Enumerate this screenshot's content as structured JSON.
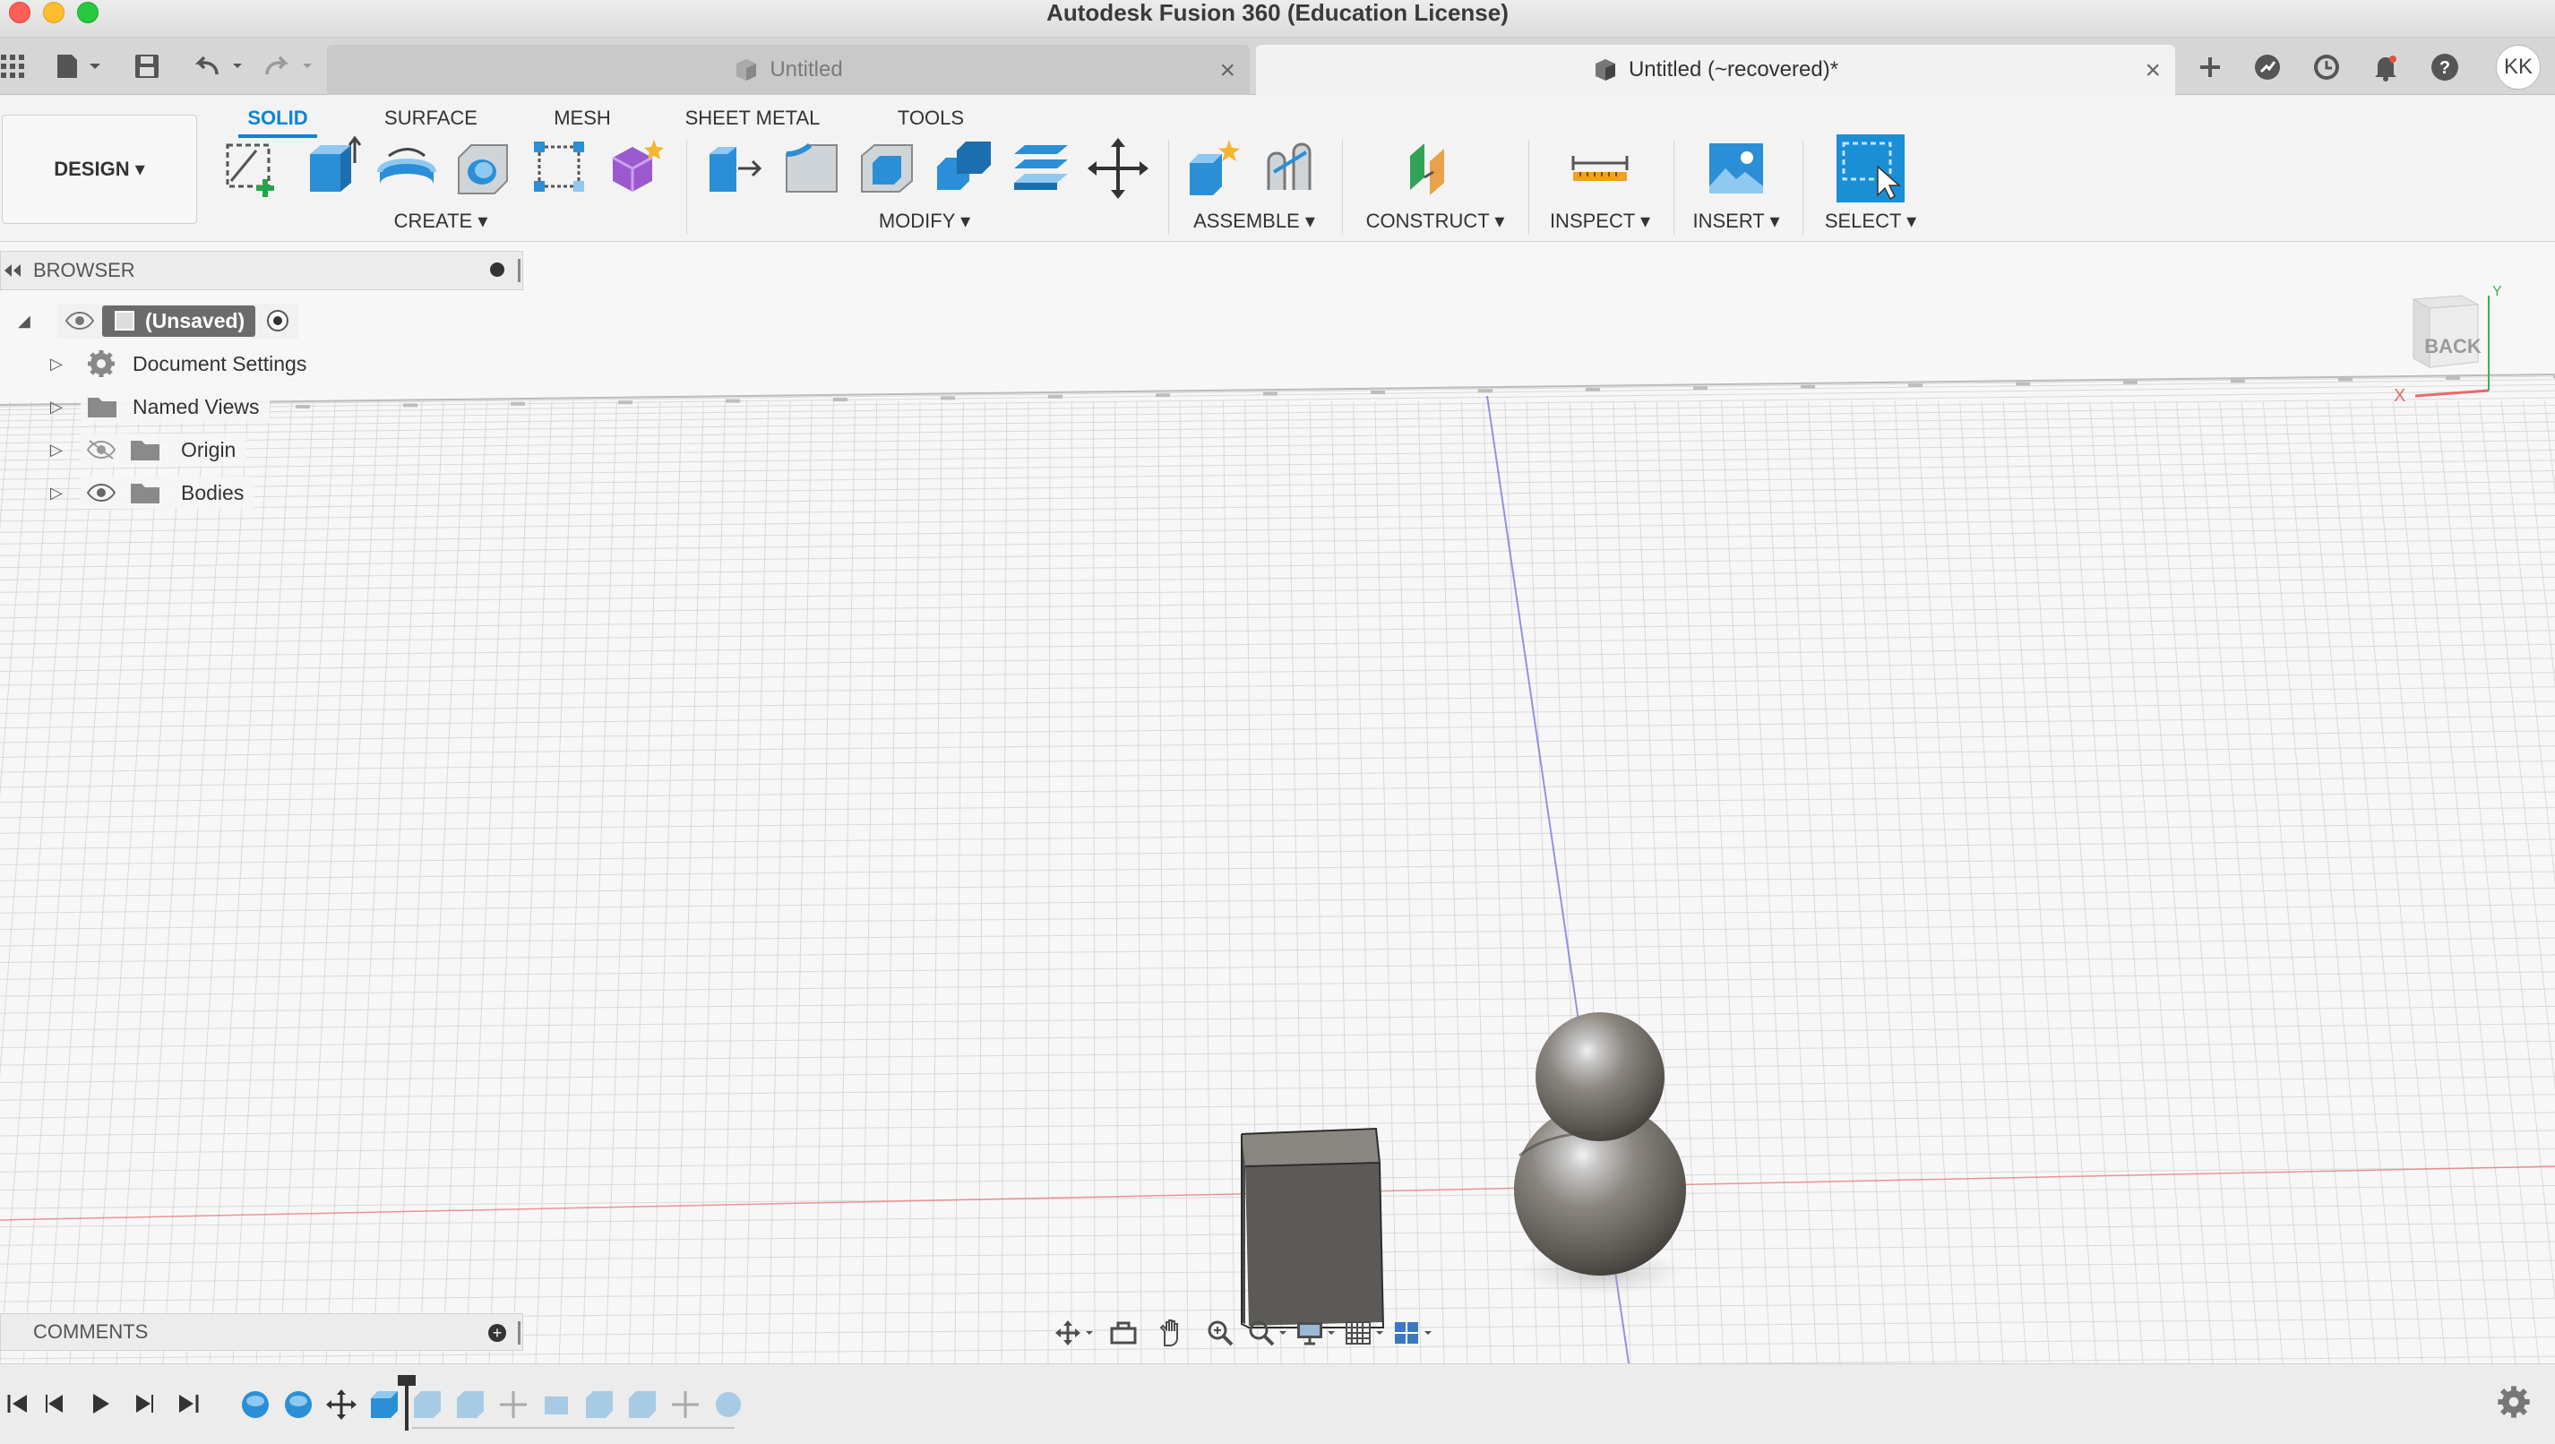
{
  "window": {
    "title": "Autodesk Fusion 360 (Education License)"
  },
  "tabs": [
    {
      "label": "Untitled",
      "active": false
    },
    {
      "label": "Untitled (~recovered)*",
      "active": true
    }
  ],
  "user": {
    "initials": "KK"
  },
  "workspace": {
    "label": "DESIGN ▾"
  },
  "ribbon_tabs": [
    "SOLID",
    "SURFACE",
    "MESH",
    "SHEET METAL",
    "TOOLS"
  ],
  "ribbon_groups": {
    "create": "CREATE ▾",
    "modify": "MODIFY ▾",
    "assemble": "ASSEMBLE ▾",
    "construct": "CONSTRUCT ▾",
    "inspect": "INSPECT ▾",
    "insert": "INSERT ▾",
    "select": "SELECT ▾"
  },
  "browser": {
    "title": "BROWSER",
    "root": "(Unsaved)",
    "items": [
      {
        "label": "Document Settings",
        "icon": "gear-icon"
      },
      {
        "label": "Named Views",
        "icon": "folder-icon"
      },
      {
        "label": "Origin",
        "icon": "folder-icon",
        "visible": false
      },
      {
        "label": "Bodies",
        "icon": "folder-icon",
        "visible": true
      }
    ]
  },
  "comments": {
    "title": "COMMENTS"
  },
  "viewcube": {
    "face": "BACK",
    "axis_x": "X",
    "axis_y": "Y"
  },
  "colors": {
    "accent": "#0a84d8",
    "select_blue": "#1a8fd6",
    "x_axis": "#e66a6a",
    "y_axis": "#7070e0"
  }
}
